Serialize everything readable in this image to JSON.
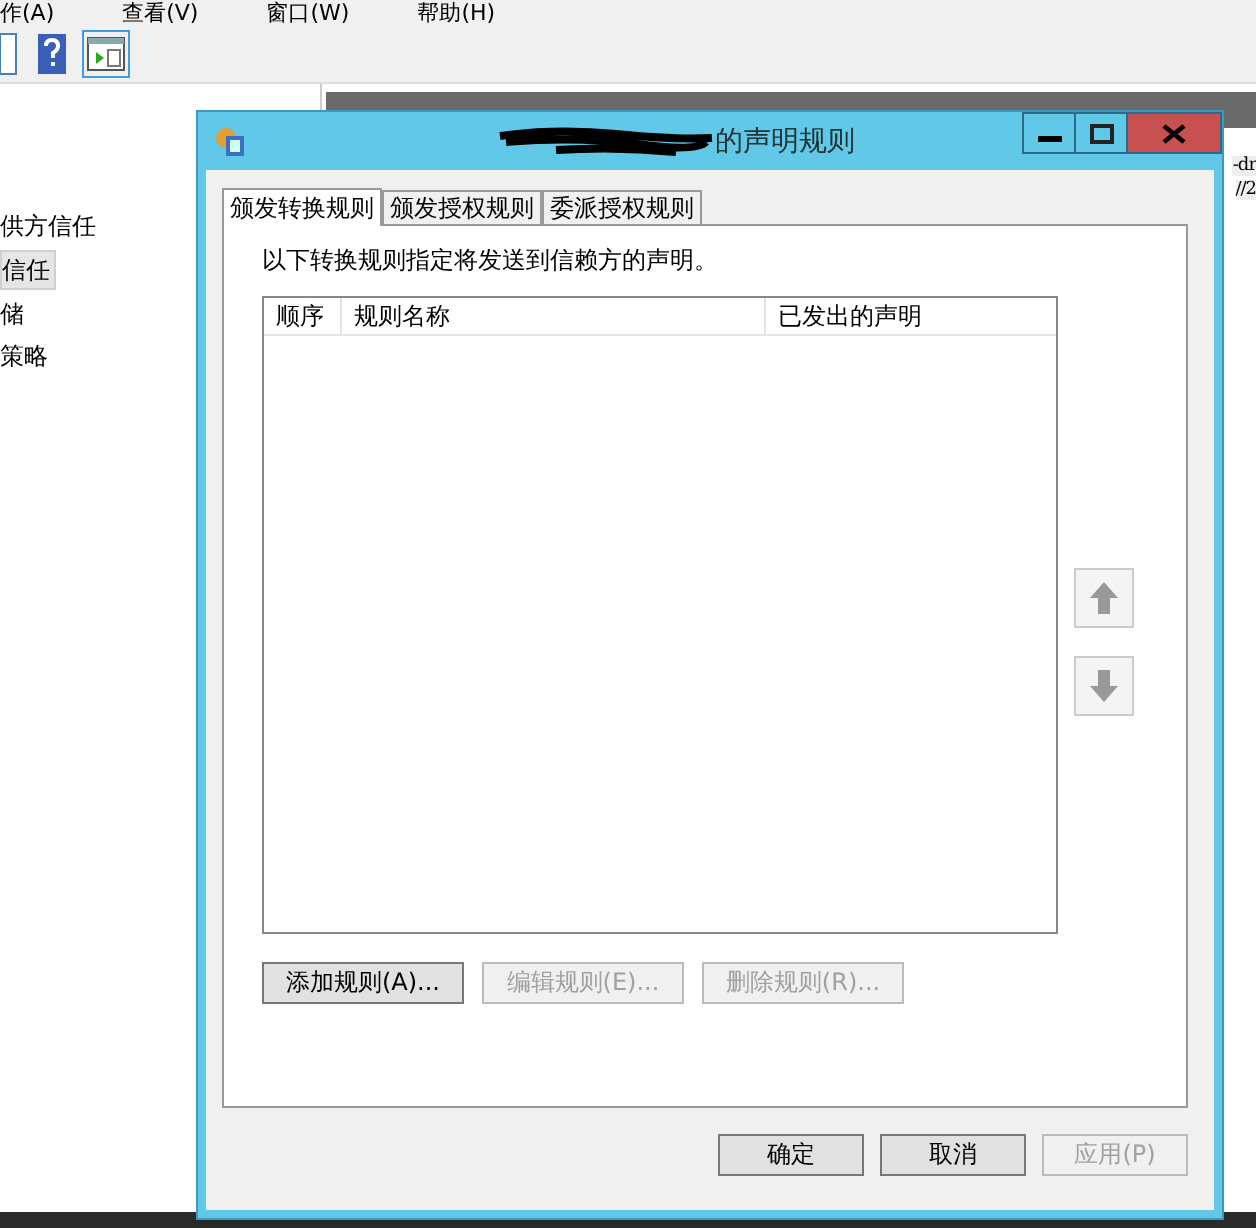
{
  "background_app": {
    "menu": [
      "作(A)",
      "查看(V)",
      "窗口(W)",
      "帮助(H)"
    ],
    "tree": [
      {
        "label": "供方信任",
        "selected": false
      },
      {
        "label": "信任",
        "selected": true
      },
      {
        "label": "储",
        "selected": false
      },
      {
        "label": "策略",
        "selected": false
      }
    ],
    "panel_lines": [
      "-dr",
      "//2"
    ]
  },
  "dialog": {
    "title": "的声明规则",
    "tabs": [
      {
        "label": "颁发转换规则",
        "selected": true
      },
      {
        "label": "颁发授权规则",
        "selected": false
      },
      {
        "label": "委派授权规则",
        "selected": false
      }
    ],
    "description": "以下转换规则指定将发送到信赖方的声明。",
    "columns": [
      "顺序",
      "规则名称",
      "已发出的声明"
    ],
    "move_buttons": [
      {
        "kind": "up",
        "disabled": true
      },
      {
        "kind": "down",
        "disabled": true
      }
    ],
    "rule_buttons": [
      {
        "label": "添加规则(A)...",
        "disabled": false
      },
      {
        "label": "编辑规则(E)...",
        "disabled": true
      },
      {
        "label": "删除规则(R)...",
        "disabled": true
      }
    ],
    "buttons": [
      {
        "label": "确定",
        "disabled": false
      },
      {
        "label": "取消",
        "disabled": false
      },
      {
        "label": "应用(P)",
        "disabled": true
      }
    ]
  }
}
